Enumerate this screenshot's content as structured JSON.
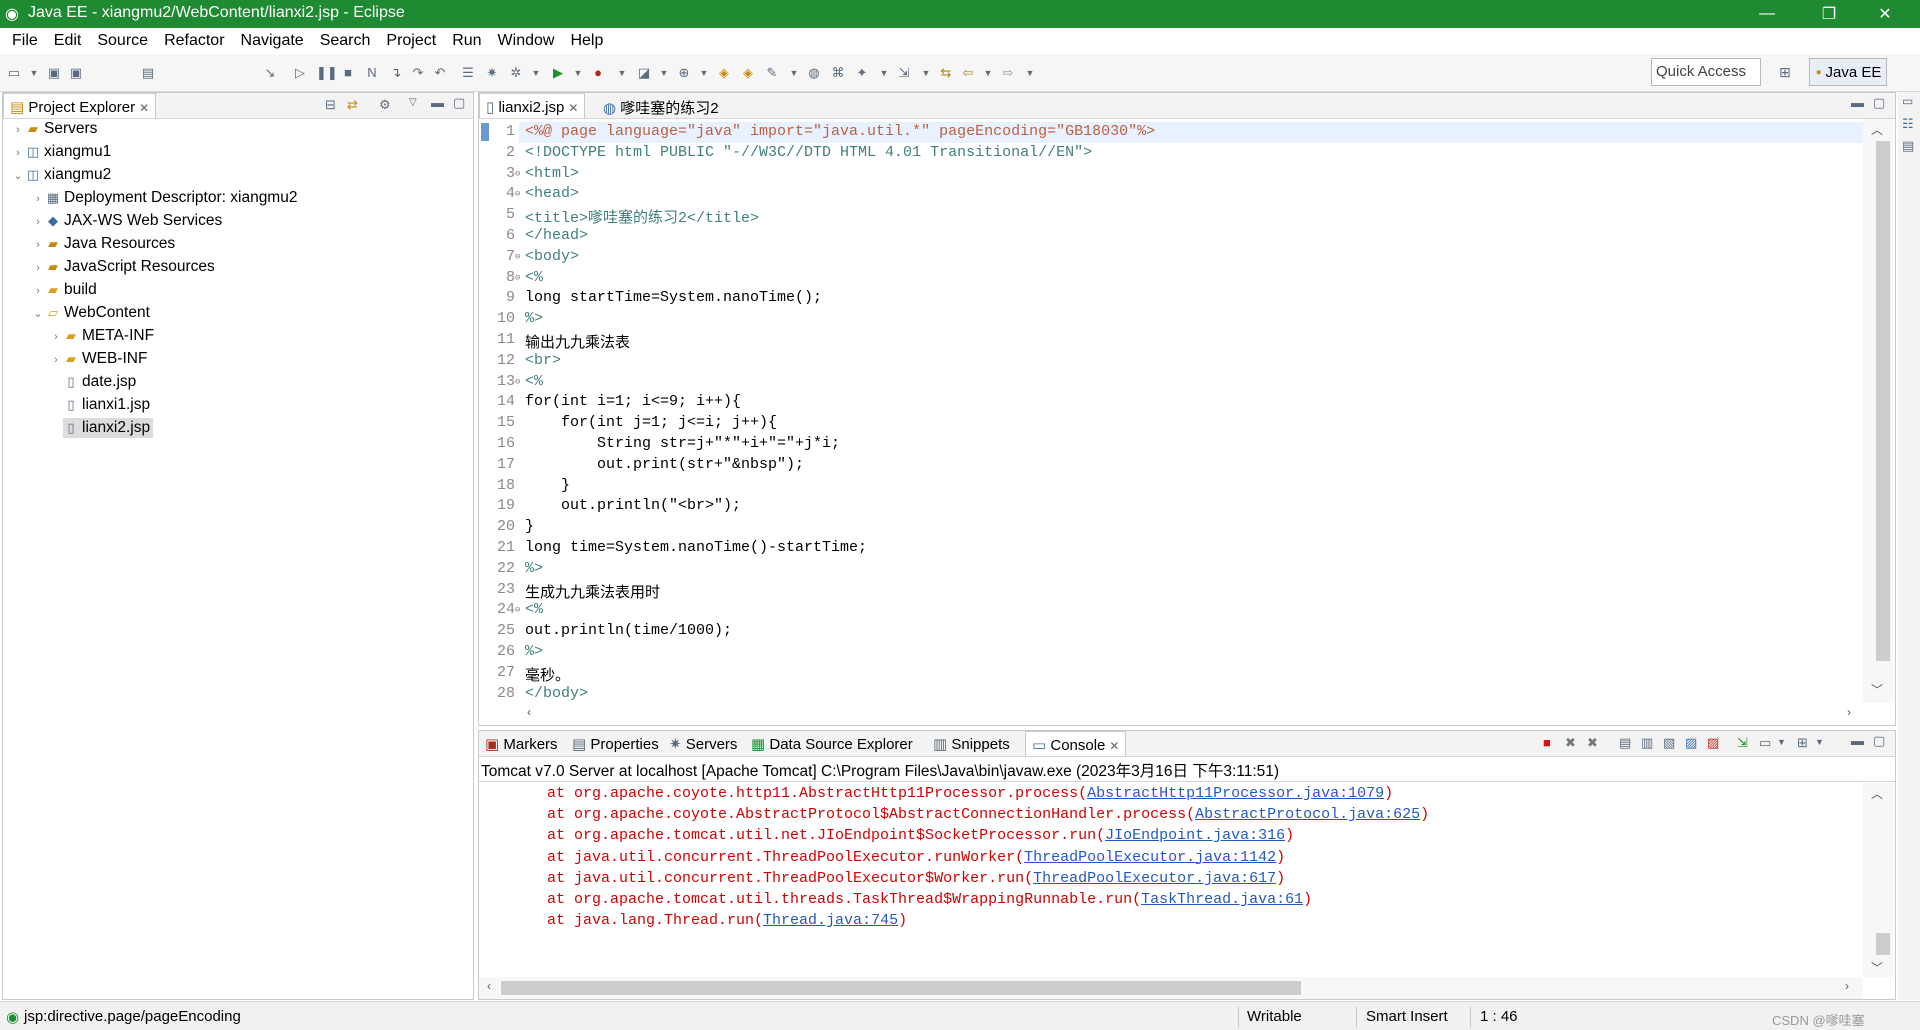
{
  "window": {
    "title": "Java EE - xiangmu2/WebContent/lianxi2.jsp - Eclipse",
    "minimize": "—",
    "restore": "❐",
    "close": "✕"
  },
  "menu": [
    "File",
    "Edit",
    "Source",
    "Refactor",
    "Navigate",
    "Search",
    "Project",
    "Run",
    "Window",
    "Help"
  ],
  "toolbar": {
    "quick_access": "Quick Access",
    "perspective": "Java EE"
  },
  "explorer": {
    "title": "Project Explorer",
    "items": [
      "Servers",
      "xiangmu1",
      "xiangmu2",
      "Deployment Descriptor: xiangmu2",
      "JAX-WS Web Services",
      "Java Resources",
      "JavaScript Resources",
      "build",
      "WebContent",
      "META-INF",
      "WEB-INF",
      "date.jsp",
      "lianxi1.jsp",
      "lianxi2.jsp"
    ]
  },
  "editor": {
    "tabs": [
      "lianxi2.jsp",
      "嗲哇塞的练习2"
    ],
    "lines": [
      {
        "n": "1",
        "t": "<%@ page language=\"java\" import=\"java.util.*\" pageEncoding=\"GB18030\"%>"
      },
      {
        "n": "2",
        "t": "<!DOCTYPE html PUBLIC \"-//W3C//DTD HTML 4.01 Transitional//EN\">"
      },
      {
        "n": "3",
        "t": "<html>"
      },
      {
        "n": "4",
        "t": "<head>"
      },
      {
        "n": "5",
        "t": "<title>嗲哇塞的练习2</title>"
      },
      {
        "n": "6",
        "t": "</head>"
      },
      {
        "n": "7",
        "t": "<body>"
      },
      {
        "n": "8",
        "t": "<%"
      },
      {
        "n": "9",
        "t": "long startTime=System.nanoTime();"
      },
      {
        "n": "10",
        "t": "%>"
      },
      {
        "n": "11",
        "t": "输出九九乘法表"
      },
      {
        "n": "12",
        "t": "<br>"
      },
      {
        "n": "13",
        "t": "<%"
      },
      {
        "n": "14",
        "t": "for(int i=1; i<=9; i++){"
      },
      {
        "n": "15",
        "t": "    for(int j=1; j<=i; j++){"
      },
      {
        "n": "16",
        "t": "        String str=j+\"*\"+i+\"=\"+j*i;"
      },
      {
        "n": "17",
        "t": "        out.print(str+\"&nbsp\");"
      },
      {
        "n": "18",
        "t": "    }"
      },
      {
        "n": "19",
        "t": "    out.println(\"<br>\");"
      },
      {
        "n": "20",
        "t": "}"
      },
      {
        "n": "21",
        "t": "long time=System.nanoTime()-startTime;"
      },
      {
        "n": "22",
        "t": "%>"
      },
      {
        "n": "23",
        "t": "生成九九乘法表用时"
      },
      {
        "n": "24",
        "t": "<%"
      },
      {
        "n": "25",
        "t": "out.println(time/1000);"
      },
      {
        "n": "26",
        "t": "%>"
      },
      {
        "n": "27",
        "t": "毫秒。"
      },
      {
        "n": "28",
        "t": "</body>"
      }
    ]
  },
  "bottom": {
    "tabs": [
      "Markers",
      "Properties",
      "Servers",
      "Data Source Explorer",
      "Snippets",
      "Console"
    ],
    "console_header": "Tomcat v7.0 Server at localhost [Apache Tomcat] C:\\Program Files\\Java\\bin\\javaw.exe (2023年3月16日 下午3:11:51)",
    "lines": [
      {
        "pre": "at org.apache.coyote.http11.AbstractHttp11Processor.process(",
        "link": "AbstractHttp11Processor.java:1079",
        "post": ")"
      },
      {
        "pre": "at org.apache.coyote.AbstractProtocol$AbstractConnectionHandler.process(",
        "link": "AbstractProtocol.java:625",
        "post": ")"
      },
      {
        "pre": "at org.apache.tomcat.util.net.JIoEndpoint$SocketProcessor.run(",
        "link": "JIoEndpoint.java:316",
        "post": ")"
      },
      {
        "pre": "at java.util.concurrent.ThreadPoolExecutor.runWorker(",
        "link": "ThreadPoolExecutor.java:1142",
        "post": ")"
      },
      {
        "pre": "at java.util.concurrent.ThreadPoolExecutor$Worker.run(",
        "link": "ThreadPoolExecutor.java:617",
        "post": ")"
      },
      {
        "pre": "at org.apache.tomcat.util.threads.TaskThread$WrappingRunnable.run(",
        "link": "TaskThread.java:61",
        "post": ")"
      },
      {
        "pre": "at java.lang.Thread.run(",
        "link": "Thread.java:745",
        "post": ")"
      }
    ]
  },
  "status": {
    "left": "jsp:directive.page/pageEncoding",
    "writable": "Writable",
    "insert": "Smart Insert",
    "pos": "1 : 46",
    "watermark": "CSDN @嗲哇塞"
  }
}
